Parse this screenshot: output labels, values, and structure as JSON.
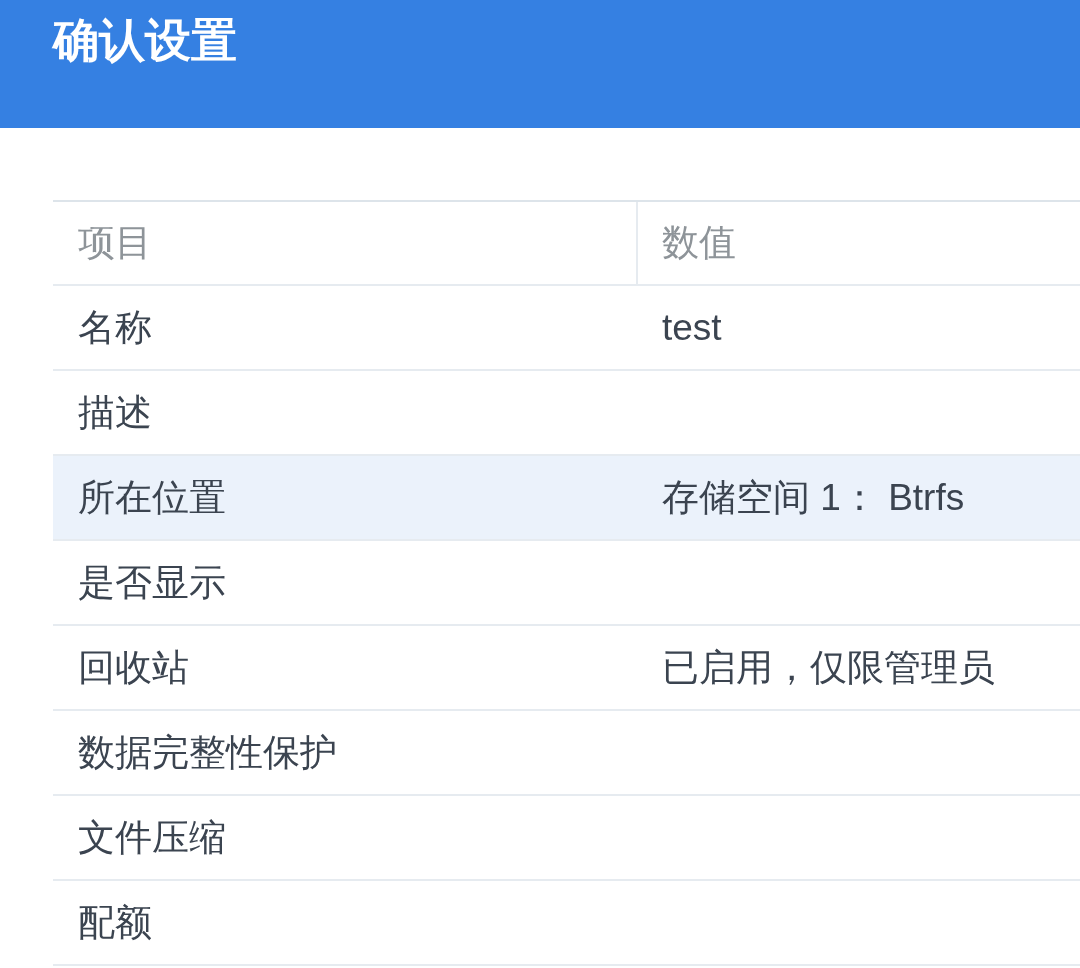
{
  "header": {
    "title": "确认设置"
  },
  "table": {
    "columns": [
      "项目",
      "数值"
    ],
    "rows": [
      {
        "item": "名称",
        "value": "test",
        "selected": false
      },
      {
        "item": "描述",
        "value": "",
        "selected": false
      },
      {
        "item": "所在位置",
        "value": "存储空间 1： Btrfs",
        "selected": true
      },
      {
        "item": "是否显示",
        "value": "",
        "selected": false
      },
      {
        "item": "回收站",
        "value": "已启用，仅限管理员",
        "selected": false
      },
      {
        "item": "数据完整性保护",
        "value": "",
        "selected": false
      },
      {
        "item": "文件压缩",
        "value": "",
        "selected": false
      },
      {
        "item": "配额",
        "value": "",
        "selected": false
      }
    ]
  }
}
